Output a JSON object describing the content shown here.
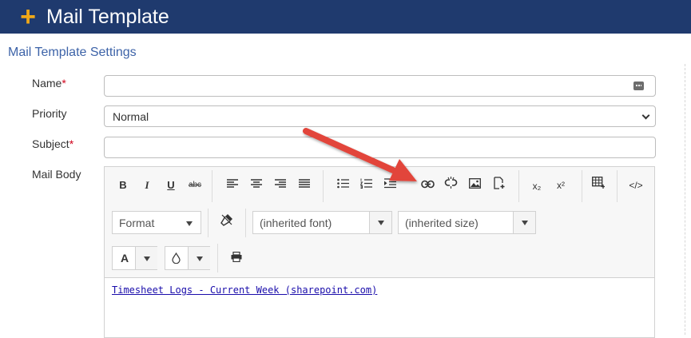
{
  "header": {
    "title": "Mail Template",
    "plus_icon": "+"
  },
  "section_title": "Mail Template Settings",
  "form": {
    "name_label": "Name",
    "priority_label": "Priority",
    "priority_value": "Normal",
    "subject_label": "Subject",
    "required_marker": "*",
    "mail_body_label": "Mail Body"
  },
  "editor": {
    "format_label": "Format",
    "font_value": "(inherited font)",
    "size_value": "(inherited size)",
    "text_color_label": "A",
    "bold": "B",
    "italic": "I",
    "underline": "U",
    "strike": "abc",
    "subscript": "x₂",
    "superscript": "x²",
    "html_view": "</>",
    "link_text": "Timesheet Logs - Current Week (sharepoint.com)"
  },
  "colors": {
    "header_bg": "#1f3a6e",
    "accent": "#f0a818",
    "section_title": "#3d63a8",
    "required": "#d0021b",
    "arrow": "#e2443a"
  }
}
